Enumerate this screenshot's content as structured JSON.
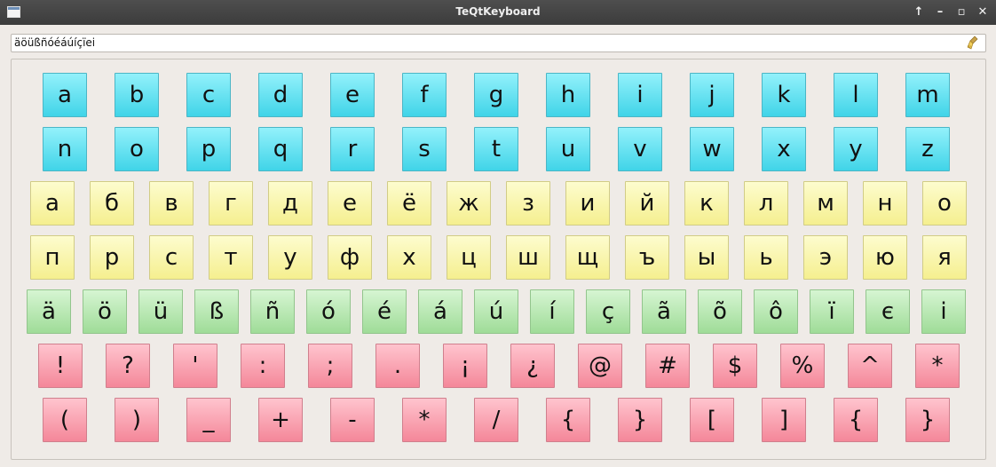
{
  "window": {
    "title": "TeQtKeyboard",
    "controls": [
      "↑",
      "–",
      "▫",
      "✕"
    ]
  },
  "input": {
    "value": "äöüßñóéáúíçïeі"
  },
  "keyboard": {
    "rows": [
      {
        "color": "cyan",
        "keys": [
          "a",
          "b",
          "c",
          "d",
          "e",
          "f",
          "g",
          "h",
          "i",
          "j",
          "k",
          "l",
          "m"
        ]
      },
      {
        "color": "cyan",
        "keys": [
          "n",
          "o",
          "p",
          "q",
          "r",
          "s",
          "t",
          "u",
          "v",
          "w",
          "x",
          "y",
          "z"
        ]
      },
      {
        "color": "yellow",
        "keys": [
          "а",
          "б",
          "в",
          "г",
          "д",
          "е",
          "ё",
          "ж",
          "з",
          "и",
          "й",
          "к",
          "л",
          "м",
          "н",
          "о"
        ]
      },
      {
        "color": "yellow",
        "keys": [
          "п",
          "р",
          "с",
          "т",
          "у",
          "ф",
          "х",
          "ц",
          "ш",
          "щ",
          "ъ",
          "ы",
          "ь",
          "э",
          "ю",
          "я"
        ]
      },
      {
        "color": "green",
        "keys": [
          "ä",
          "ö",
          "ü",
          "ß",
          "ñ",
          "ó",
          "é",
          "á",
          "ú",
          "í",
          "ç",
          "ã",
          "õ",
          "ô",
          "ї",
          "є",
          "і"
        ]
      },
      {
        "color": "pink",
        "keys": [
          "!",
          "?",
          "'",
          ":",
          ";",
          ".",
          "¡",
          "¿",
          "@",
          "#",
          "$",
          "%",
          "^",
          "*"
        ]
      },
      {
        "color": "pink",
        "keys": [
          "(",
          ")",
          "_",
          "+",
          "-",
          "*",
          "/",
          "{",
          "}",
          "[",
          "]",
          "{",
          "}"
        ]
      }
    ]
  },
  "colors": {
    "cyan": "#40d4e8",
    "yellow": "#f5ef8f",
    "green": "#9fdc98",
    "pink": "#f48799"
  }
}
